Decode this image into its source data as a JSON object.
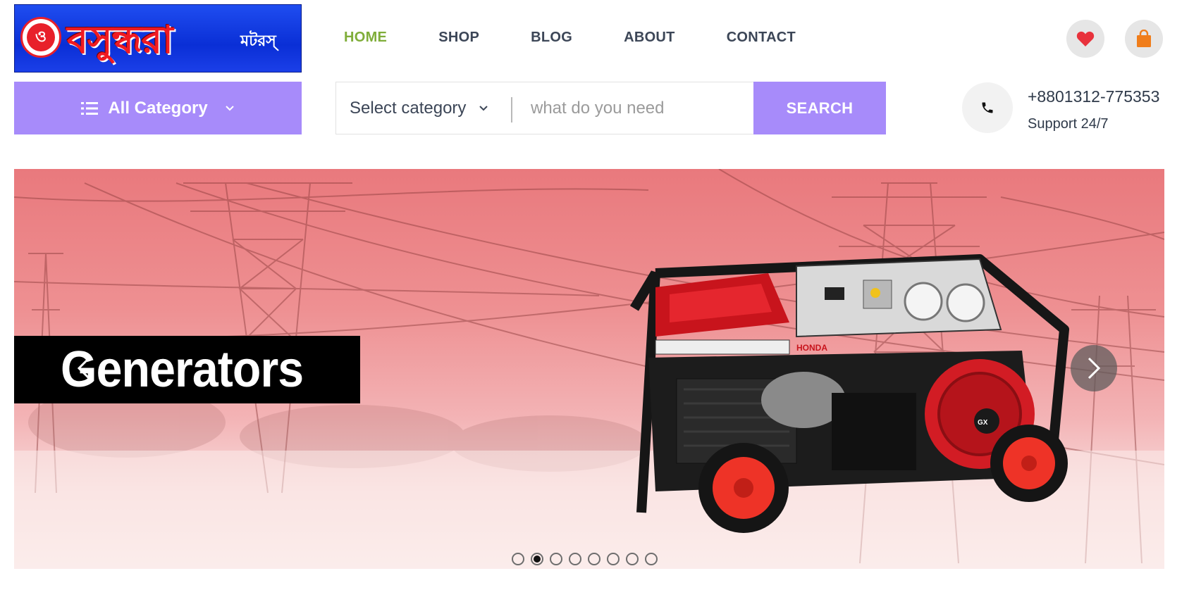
{
  "logo": {
    "emblem": "ও",
    "main_text": "বসুন্ধরা",
    "sub_text": "মটরস্"
  },
  "nav": {
    "items": [
      {
        "label": "HOME",
        "active": true
      },
      {
        "label": "SHOP",
        "active": false
      },
      {
        "label": "BLOG",
        "active": false
      },
      {
        "label": "ABOUT",
        "active": false
      },
      {
        "label": "CONTACT",
        "active": false
      }
    ]
  },
  "header_icons": {
    "wishlist": "heart-icon",
    "cart": "shopping-bag-icon"
  },
  "categories": {
    "label": "All Category"
  },
  "search": {
    "category_select": "Select category",
    "placeholder": "what do you need",
    "button_label": "SEARCH"
  },
  "contact": {
    "phone": "+8801312-775353",
    "support": "Support 24/7"
  },
  "hero": {
    "title": "Generators",
    "slide_count": 8,
    "active_slide": 2
  },
  "colors": {
    "accent": "#a78bfa",
    "nav_active": "#7fad39",
    "heart": "#e8323c",
    "bag": "#f07d1a"
  }
}
